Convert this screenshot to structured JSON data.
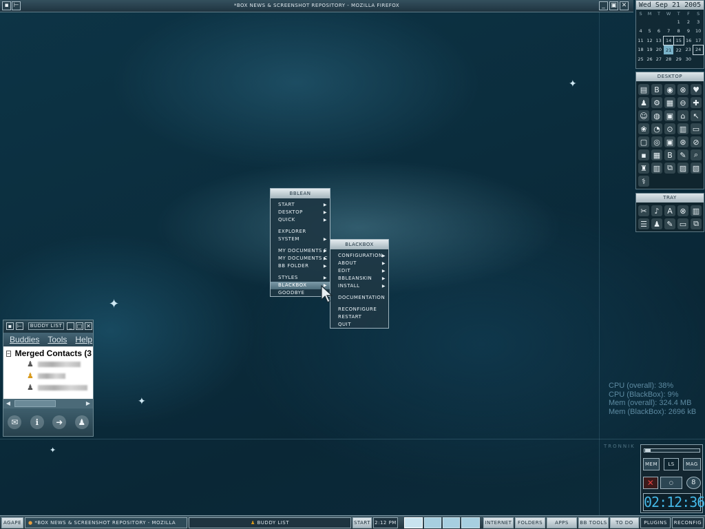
{
  "window": {
    "title": "*BOX NEWS & SCREENSHOT REPOSITORY - MOZILLA FIREFOX"
  },
  "calendar": {
    "header": "Wed Sep 21 2005",
    "weekdays": [
      "S",
      "M",
      "T",
      "W",
      "T",
      "F",
      "S"
    ],
    "weeks": [
      [
        "",
        "",
        "",
        "",
        "1",
        "2",
        "3"
      ],
      [
        "4",
        "5",
        "6",
        "7",
        "8",
        "9",
        "10"
      ],
      [
        "11",
        "12",
        "13",
        "14",
        "15",
        "16",
        "17"
      ],
      [
        "18",
        "19",
        "20",
        "21",
        "22",
        "23",
        "24"
      ],
      [
        "25",
        "26",
        "27",
        "28",
        "29",
        "30",
        ""
      ]
    ],
    "today": "21"
  },
  "desktop_panel": {
    "title": "DESKTOP"
  },
  "tray_panel": {
    "title": "TRAY"
  },
  "bblean_menu": {
    "title": "BBLEAN",
    "items": [
      {
        "label": "START",
        "submenu": true
      },
      {
        "label": "DESKTOP",
        "submenu": true
      },
      {
        "label": "QUICK",
        "submenu": true
      },
      {
        "label": "EXPLORER",
        "submenu": false
      },
      {
        "label": "SYSTEM",
        "submenu": true
      },
      {
        "label": "MY DOCUMENTS F",
        "submenu": true
      },
      {
        "label": "MY DOCUMENTS C",
        "submenu": true
      },
      {
        "label": "BB FOLDER",
        "submenu": true
      },
      {
        "label": "STYLES",
        "submenu": true
      },
      {
        "label": "BLACKBOX",
        "submenu": true
      },
      {
        "label": "GOODBYE",
        "submenu": false
      }
    ]
  },
  "blackbox_menu": {
    "title": "BLACKBOX",
    "items": [
      {
        "label": "CONFIGURATION",
        "submenu": true
      },
      {
        "label": "ABOUT",
        "submenu": true
      },
      {
        "label": "EDIT",
        "submenu": true
      },
      {
        "label": "BBLEANSKIN",
        "submenu": true
      },
      {
        "label": "INSTALL",
        "submenu": true
      },
      {
        "label": "DOCUMENTATION",
        "submenu": false
      },
      {
        "label": "RECONFIGURE",
        "submenu": false
      },
      {
        "label": "RESTART",
        "submenu": false
      },
      {
        "label": "QUIT",
        "submenu": false
      }
    ]
  },
  "buddy_list": {
    "title": "BUDDY LIST",
    "menu": [
      "Buddies",
      "Tools",
      "Help"
    ],
    "group": "Merged Contacts (3"
  },
  "stats": {
    "cpu_overall": "CPU (overall): 38%",
    "cpu_blackbox": "CPU (BlackBox): 9%",
    "mem_overall": "Mem (overall): 324.4 MB",
    "mem_blackbox": "Mem (BlackBox): 2696 kB"
  },
  "brand": "TRONNIK",
  "sysmon": {
    "mem": "MEM",
    "ls": "LS",
    "mag": "MAG",
    "clock": "02:12:36"
  },
  "taskbar": {
    "agape": "AGAPE",
    "firefox_task": "*BOX NEWS & SCREENSHOT REPOSITORY - MOZILLA FIREF...",
    "buddy_task": "BUDDY LIST",
    "start": "START",
    "time": "2:12 PM",
    "internet": "INTERNET",
    "folders": "FOLDERS",
    "apps": "APPS",
    "bbtools": "BB TOOLS",
    "todo": "TO DO",
    "plugins": "PLUGINS",
    "reconfig": "RECONFIG"
  }
}
